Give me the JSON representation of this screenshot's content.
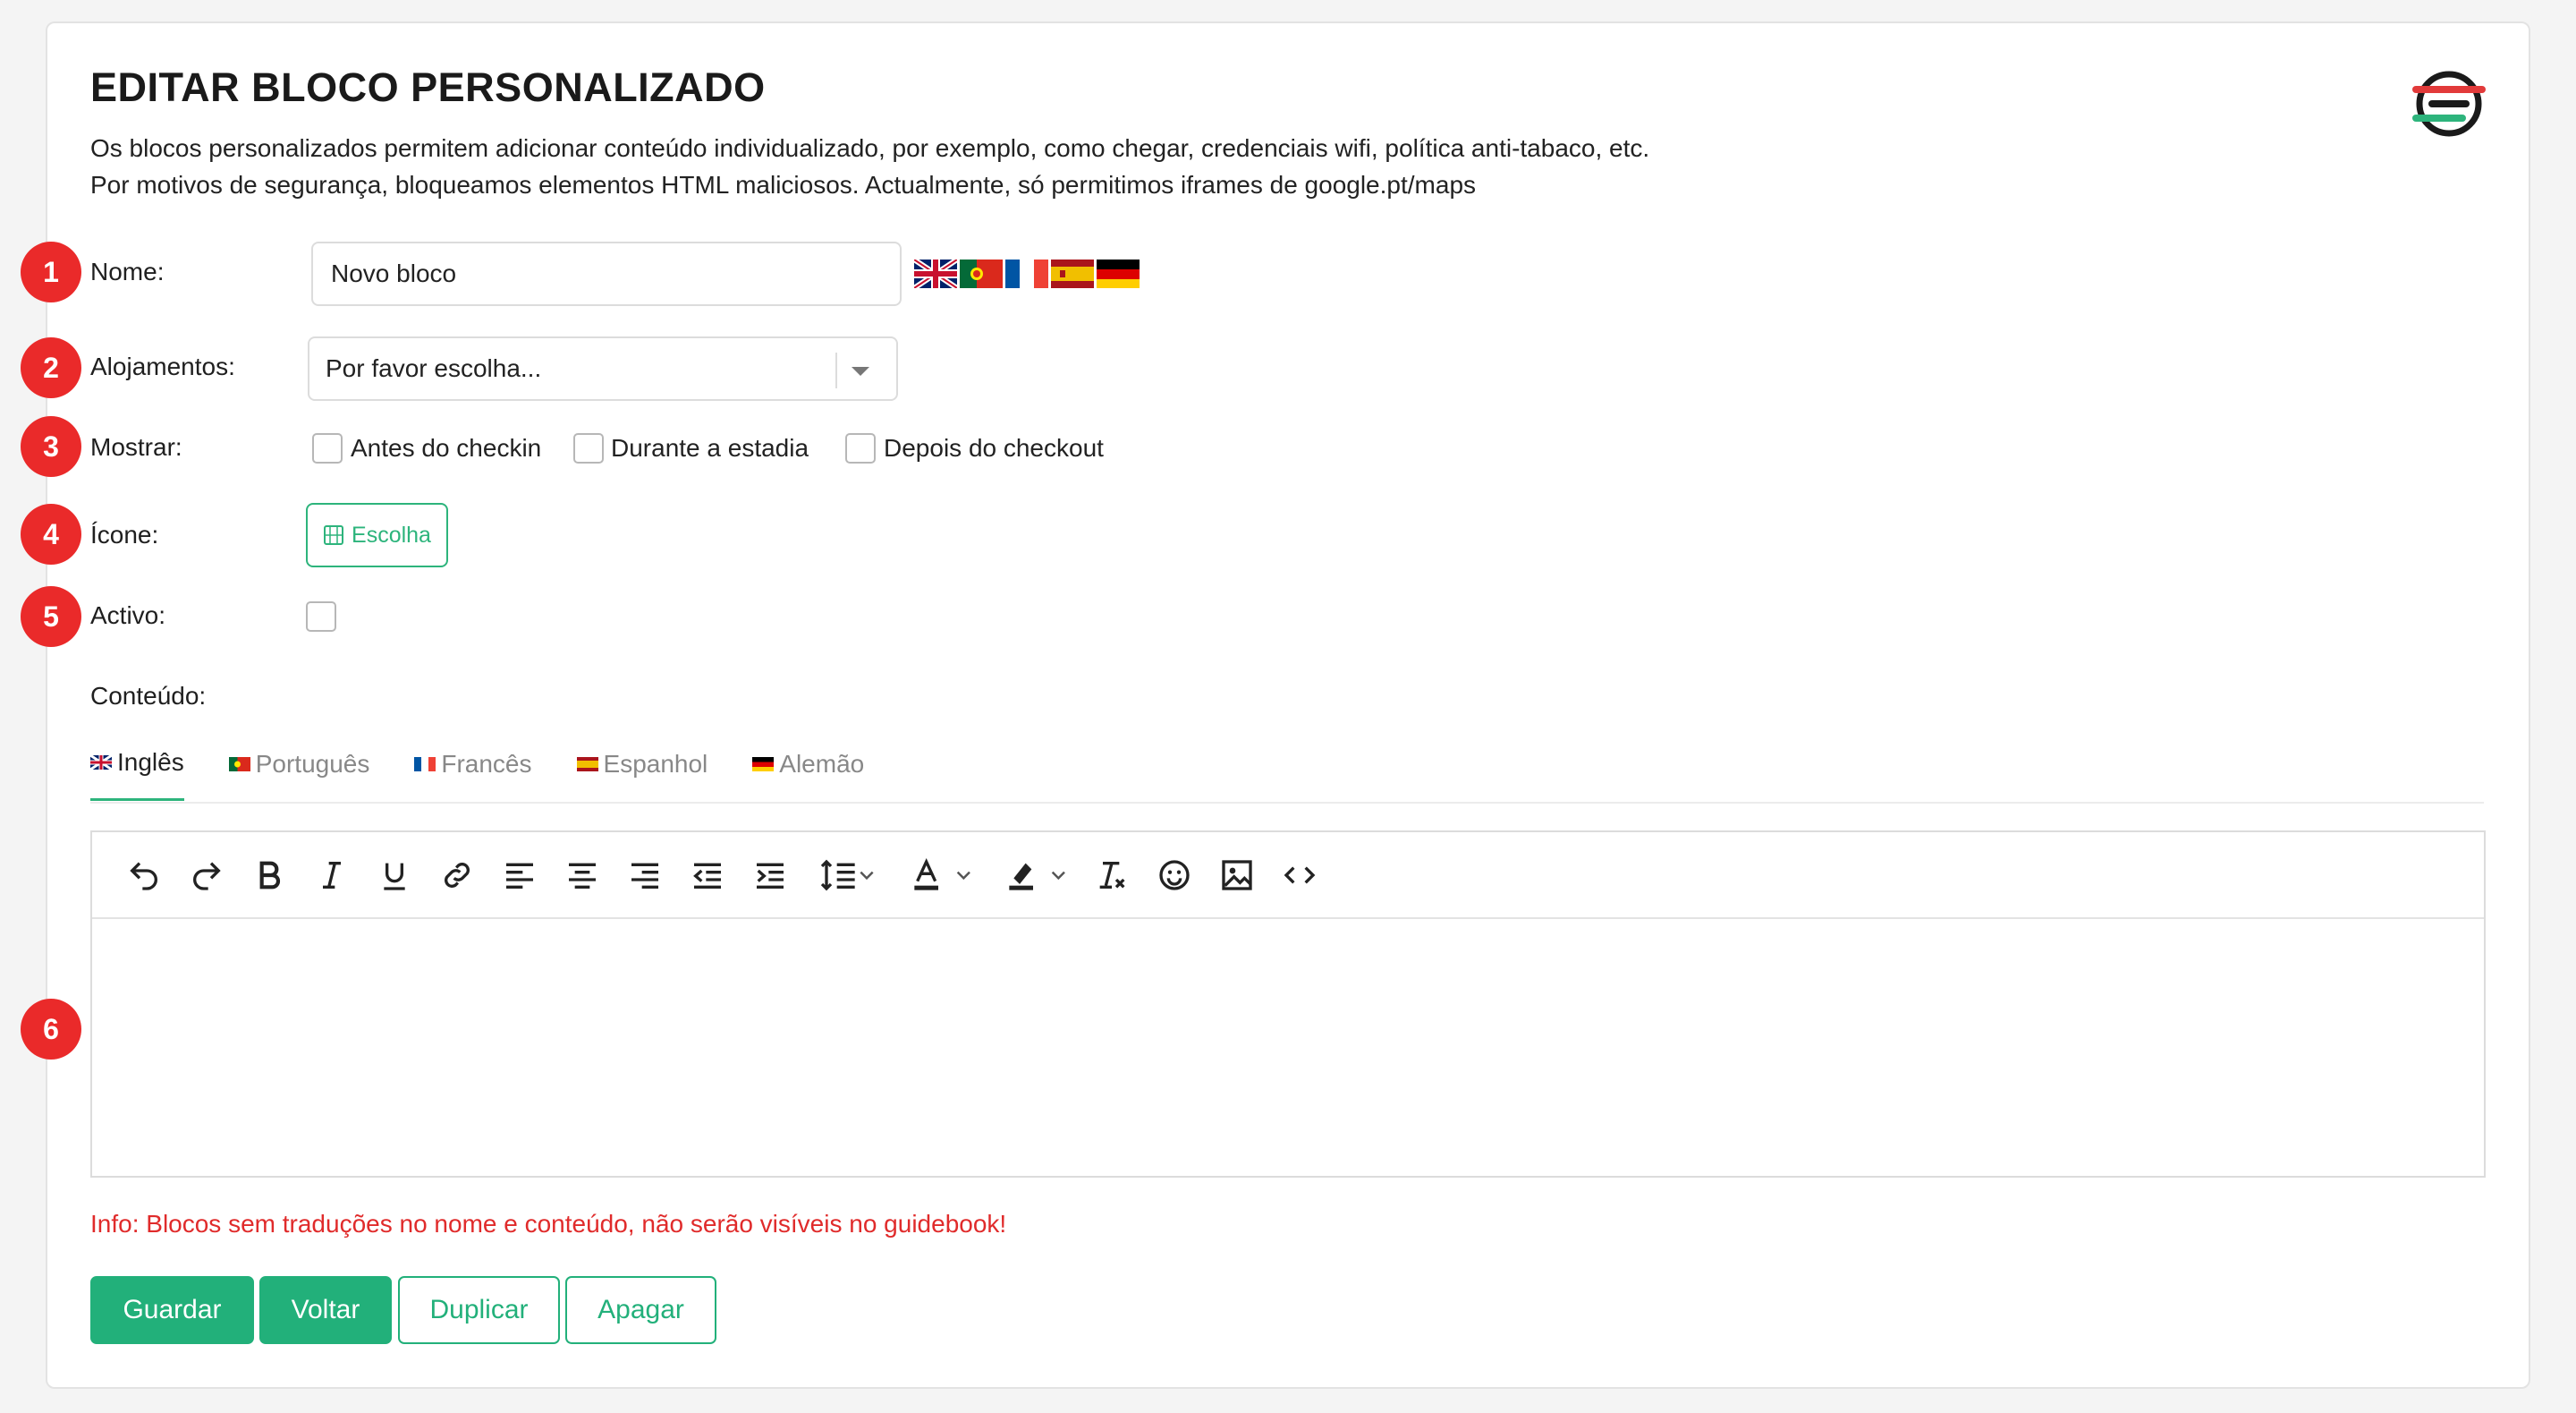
{
  "title": "EDITAR BLOCO PERSONALIZADO",
  "description": [
    "Os blocos personalizados permitem adicionar conteúdo individualizado, por exemplo, como chegar, credenciais wifi, política anti-tabaco, etc.",
    "Por motivos de segurança, bloqueamos elementos HTML maliciosos. Actualmente, só permitimos iframes de google.pt/maps"
  ],
  "badges": [
    "1",
    "2",
    "3",
    "4",
    "5",
    "6"
  ],
  "form": {
    "name_label": "Nome:",
    "name_value": "Novo bloco",
    "name_flags": [
      "uk-flag-icon",
      "portugal-flag-icon",
      "france-flag-icon",
      "spain-flag-icon",
      "germany-flag-icon"
    ],
    "accommodations_label": "Alojamentos:",
    "accommodations_value": "Por favor escolha...",
    "show_label": "Mostrar:",
    "show_options": [
      {
        "label": "Antes do checkin",
        "checked": false
      },
      {
        "label": "Durante a estadia",
        "checked": false
      },
      {
        "label": "Depois do checkout",
        "checked": false
      }
    ],
    "icon_label": "Ícone:",
    "icon_button": "Escolha",
    "active_label": "Activo:",
    "active_checked": false,
    "content_label": "Conteúdo:"
  },
  "tabs": [
    {
      "label": "Inglês",
      "flag": "uk-flag-icon",
      "active": true
    },
    {
      "label": "Português",
      "flag": "portugal-flag-icon",
      "active": false
    },
    {
      "label": "Francês",
      "flag": "france-flag-icon",
      "active": false
    },
    {
      "label": "Espanhol",
      "flag": "spain-flag-icon",
      "active": false
    },
    {
      "label": "Alemão",
      "flag": "germany-flag-icon",
      "active": false
    }
  ],
  "toolbar": [
    "undo-icon",
    "redo-icon",
    "bold-icon",
    "italic-icon",
    "underline-icon",
    "link-icon",
    "align-left-icon",
    "align-center-icon",
    "align-right-icon",
    "outdent-icon",
    "indent-icon",
    "line-height-icon",
    "text-color-icon",
    "highlight-icon",
    "clear-format-icon",
    "emoji-icon",
    "image-icon",
    "code-icon"
  ],
  "editor_content": "",
  "info": "Info: Blocos sem traduções no nome e conteúdo, não serão visíveis no guidebook!",
  "buttons": {
    "save": "Guardar",
    "back": "Voltar",
    "duplicate": "Duplicar",
    "delete": "Apagar"
  },
  "colors": {
    "accent": "#22b07a",
    "badge": "#ea2a2a",
    "info": "#e02b2b"
  }
}
